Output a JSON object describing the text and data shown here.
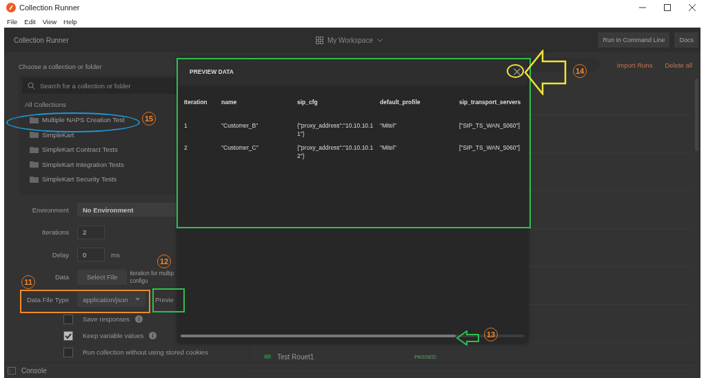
{
  "window": {
    "title": "Collection Runner"
  },
  "menu": [
    "File",
    "Edit",
    "View",
    "Help"
  ],
  "header": {
    "title": "Collection Runner",
    "workspace": "My Workspace",
    "buttons": [
      "Run In Command Line",
      "Docs"
    ]
  },
  "collections": {
    "heading": "Choose a collection or folder",
    "search": {
      "placeholder": "Search for a collection or folder"
    },
    "group": "All Collections",
    "items": [
      {
        "name": "Multiple NAPS Creation Test"
      },
      {
        "name": "SimpleKart"
      },
      {
        "name": "SimpleKart Contract Tests"
      },
      {
        "name": "SimpleKart Integration Tests"
      },
      {
        "name": "SimpleKart Security Tests"
      }
    ]
  },
  "settings": {
    "environment": {
      "label": "Environment",
      "value": "No Environment"
    },
    "iterations": {
      "label": "Iterations",
      "value": "2"
    },
    "delay": {
      "label": "Delay",
      "value": "0",
      "unit": "ms"
    },
    "data": {
      "label": "Data",
      "button": "Select File",
      "note": [
        "iteration for multip",
        "configu"
      ]
    },
    "data_file_type": {
      "label": "Data File Type",
      "value": "application/json",
      "preview": "Previe"
    },
    "options": [
      {
        "label": "Save responses",
        "checked": false,
        "info": true
      },
      {
        "label": "Keep variable values",
        "checked": true,
        "info": true
      },
      {
        "label": "Run collection without using stored cookies",
        "checked": false,
        "info": false
      }
    ]
  },
  "runs": {
    "actions": [
      "Import Runs",
      "Delete all"
    ],
    "items": [
      {
        "name": "Test Rouet1",
        "status": "PASSED"
      }
    ]
  },
  "console": "Console",
  "preview": {
    "title": "PREVIEW DATA",
    "columns": [
      "Iteration",
      "name",
      "sip_cfg",
      "default_profile",
      "sip_transport_servers"
    ],
    "rows": [
      [
        "1",
        "\"Customer_B\"",
        "{\"proxy_address\":\"10.10.10.11\"}",
        "\"Mitel\"",
        "[\"SIP_TS_WAN_5060\"]"
      ],
      [
        "2",
        "\"Customer_C\"",
        "{\"proxy_address\":\"10.10.10.12\"}",
        "\"Mitel\"",
        "[\"SIP_TS_WAN_5060\"]"
      ]
    ],
    "scroll": {
      "level": 0.8
    }
  },
  "annotations": [
    {
      "label": "15"
    },
    {
      "label": "14"
    },
    {
      "label": "13"
    },
    {
      "label": "11"
    },
    {
      "label": "12"
    }
  ]
}
